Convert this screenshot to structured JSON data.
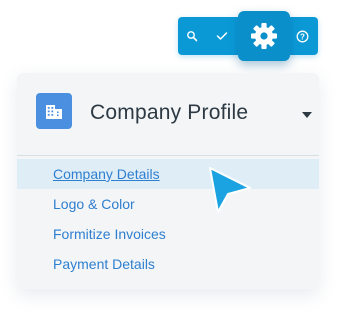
{
  "toolbar": {
    "icons": [
      "search-icon",
      "check-icon",
      "gear-icon",
      "help-icon"
    ],
    "help_glyph": "?"
  },
  "card": {
    "title": "Company Profile",
    "icon": "building-icon",
    "caret_icon": "caret-down-icon"
  },
  "menu": {
    "items": [
      {
        "label": "Company Details",
        "active": true
      },
      {
        "label": "Logo & Color",
        "active": false
      },
      {
        "label": "Formitize Invoices",
        "active": false
      },
      {
        "label": "Payment Details",
        "active": false
      }
    ]
  },
  "colors": {
    "toolbar": "#0b99d6",
    "gear_button": "#0a8fcb",
    "badge": "#4a8fe0",
    "link": "#2f7fd0",
    "active_row": "#dfeef6",
    "cursor": "#1aa3e0"
  }
}
